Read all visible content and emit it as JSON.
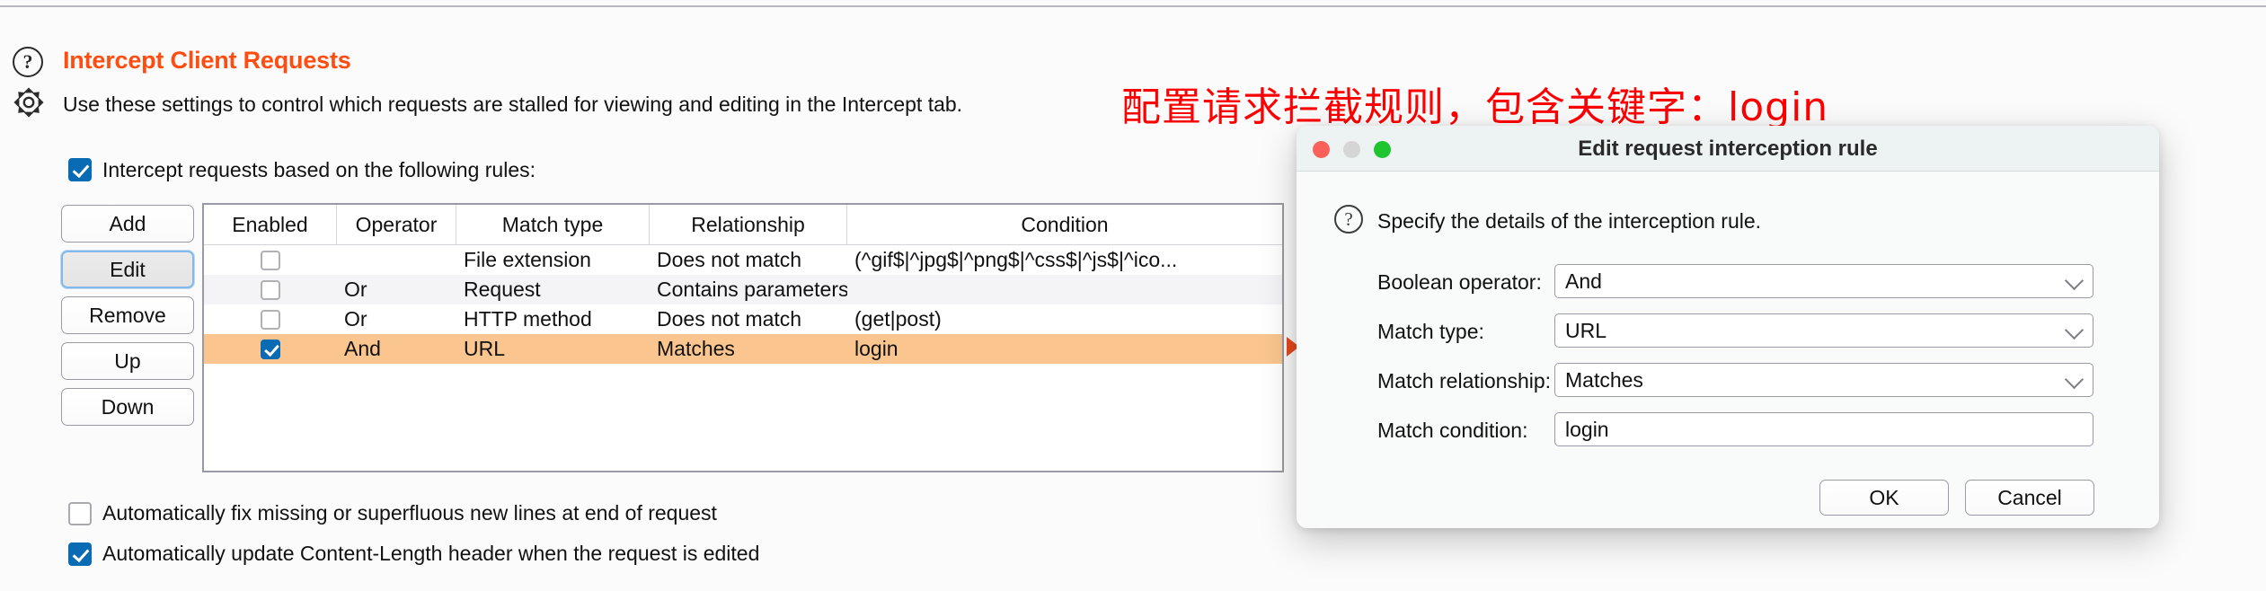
{
  "header": {
    "title": "Intercept Client Requests",
    "subtitle": "Use these settings to control which requests are stalled for viewing and editing in the Intercept tab.",
    "help_glyph": "?",
    "title_color": "#ff4d12"
  },
  "annotation": {
    "text": "配置请求拦截规则，包含关键字：login",
    "color": "#ff0000"
  },
  "options": {
    "intercept_rules_label": "Intercept requests based on the following rules:",
    "intercept_rules_checked": "true",
    "fix_newlines_label": "Automatically fix missing or superfluous new lines at end of request",
    "fix_newlines_checked": "false",
    "content_length_label": "Automatically update Content-Length header when the request is edited",
    "content_length_checked": "true"
  },
  "side_buttons": {
    "add": "Add",
    "edit": "Edit",
    "remove": "Remove",
    "up": "Up",
    "down": "Down",
    "selected": "Edit"
  },
  "rules_table": {
    "columns": [
      "Enabled",
      "Operator",
      "Match type",
      "Relationship",
      "Condition"
    ],
    "rows": [
      {
        "enabled": "false",
        "operator": "",
        "match_type": "File extension",
        "relationship": "Does not match",
        "condition": "(^gif$|^jpg$|^png$|^css$|^js$|^ico...",
        "selected": "false"
      },
      {
        "enabled": "false",
        "operator": "Or",
        "match_type": "Request",
        "relationship": "Contains parameters",
        "condition": "",
        "selected": "false"
      },
      {
        "enabled": "false",
        "operator": "Or",
        "match_type": "HTTP method",
        "relationship": "Does not match",
        "condition": "(get|post)",
        "selected": "false"
      },
      {
        "enabled": "true",
        "operator": "And",
        "match_type": "URL",
        "relationship": "Matches",
        "condition": "login",
        "selected": "true"
      }
    ],
    "selected_row_color": "#fac58e",
    "marker_color": "#e8491b"
  },
  "dialog": {
    "title": "Edit request interception rule",
    "description": "Specify the details of the interception rule.",
    "help_glyph": "?",
    "traffic_lights": {
      "close": "#fa6159",
      "minimize": "#d5d5d5",
      "zoom": "#1fc52f"
    },
    "fields": [
      {
        "label": "Boolean operator:",
        "value": "And",
        "type": "select"
      },
      {
        "label": "Match type:",
        "value": "URL",
        "type": "select"
      },
      {
        "label": "Match relationship:",
        "value": "Matches",
        "type": "select"
      },
      {
        "label": "Match condition:",
        "value": "login",
        "type": "text"
      }
    ],
    "ok_label": "OK",
    "cancel_label": "Cancel"
  }
}
